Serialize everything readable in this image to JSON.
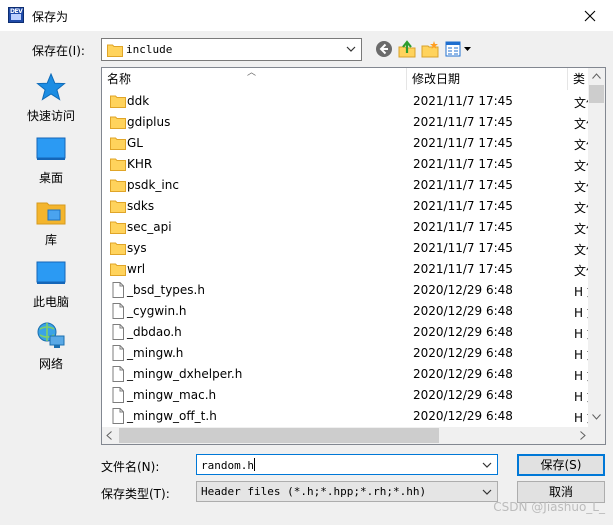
{
  "window": {
    "title": "保存为",
    "app_icon_text": "DEV"
  },
  "location": {
    "label": "保存在(I):",
    "value": "include"
  },
  "toolbar": [
    "back-icon",
    "up-folder-icon",
    "new-folder-icon",
    "view-menu-icon"
  ],
  "places": [
    {
      "label": "快速访问",
      "icon": "quick-access-star-icon"
    },
    {
      "label": "桌面",
      "icon": "desktop-icon"
    },
    {
      "label": "库",
      "icon": "library-icon"
    },
    {
      "label": "此电脑",
      "icon": "this-pc-icon"
    },
    {
      "label": "网络",
      "icon": "network-icon"
    }
  ],
  "columns": {
    "name": "名称",
    "date": "修改日期",
    "type": "类型"
  },
  "files": [
    {
      "name": "ddk",
      "date": "2021/11/7 17:45",
      "type": "文件夹",
      "kind": "folder"
    },
    {
      "name": "gdiplus",
      "date": "2021/11/7 17:45",
      "type": "文件夹",
      "kind": "folder"
    },
    {
      "name": "GL",
      "date": "2021/11/7 17:45",
      "type": "文件夹",
      "kind": "folder"
    },
    {
      "name": "KHR",
      "date": "2021/11/7 17:45",
      "type": "文件夹",
      "kind": "folder"
    },
    {
      "name": "psdk_inc",
      "date": "2021/11/7 17:45",
      "type": "文件夹",
      "kind": "folder"
    },
    {
      "name": "sdks",
      "date": "2021/11/7 17:45",
      "type": "文件夹",
      "kind": "folder"
    },
    {
      "name": "sec_api",
      "date": "2021/11/7 17:45",
      "type": "文件夹",
      "kind": "folder"
    },
    {
      "name": "sys",
      "date": "2021/11/7 17:45",
      "type": "文件夹",
      "kind": "folder"
    },
    {
      "name": "wrl",
      "date": "2021/11/7 17:45",
      "type": "文件夹",
      "kind": "folder"
    },
    {
      "name": "_bsd_types.h",
      "date": "2020/12/29 6:48",
      "type": "H 文件",
      "kind": "file"
    },
    {
      "name": "_cygwin.h",
      "date": "2020/12/29 6:48",
      "type": "H 文件",
      "kind": "file"
    },
    {
      "name": "_dbdao.h",
      "date": "2020/12/29 6:48",
      "type": "H 文件",
      "kind": "file"
    },
    {
      "name": "_mingw.h",
      "date": "2020/12/29 6:48",
      "type": "H 文件",
      "kind": "file"
    },
    {
      "name": "_mingw_dxhelper.h",
      "date": "2020/12/29 6:48",
      "type": "H 文件",
      "kind": "file"
    },
    {
      "name": "_mingw_mac.h",
      "date": "2020/12/29 6:48",
      "type": "H 文件",
      "kind": "file"
    },
    {
      "name": "_mingw_off_t.h",
      "date": "2020/12/29 6:48",
      "type": "H 文件",
      "kind": "file"
    }
  ],
  "filename": {
    "label": "文件名(N):",
    "value": "random.h"
  },
  "filetype": {
    "label": "保存类型(T):",
    "value": "Header files (*.h;*.hpp;*.rh;*.hh)"
  },
  "buttons": {
    "save": "保存(S)",
    "cancel": "取消"
  },
  "watermark": "CSDN @Jiashuo_L_"
}
